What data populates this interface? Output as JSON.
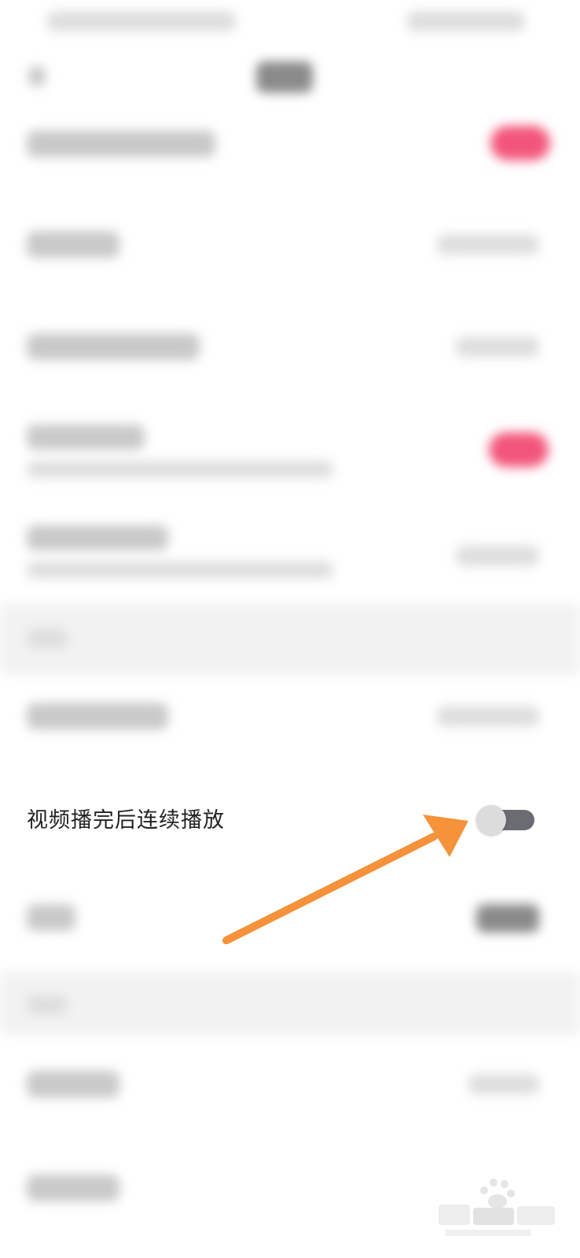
{
  "setting_row": {
    "label": "视频播完后连续播放",
    "toggle_state": "off"
  },
  "colors": {
    "arrow": "#f5923a",
    "toggle_track": "#6b6c72",
    "toggle_knob": "#dcdcdc",
    "accent_pink": "#f2557a"
  }
}
